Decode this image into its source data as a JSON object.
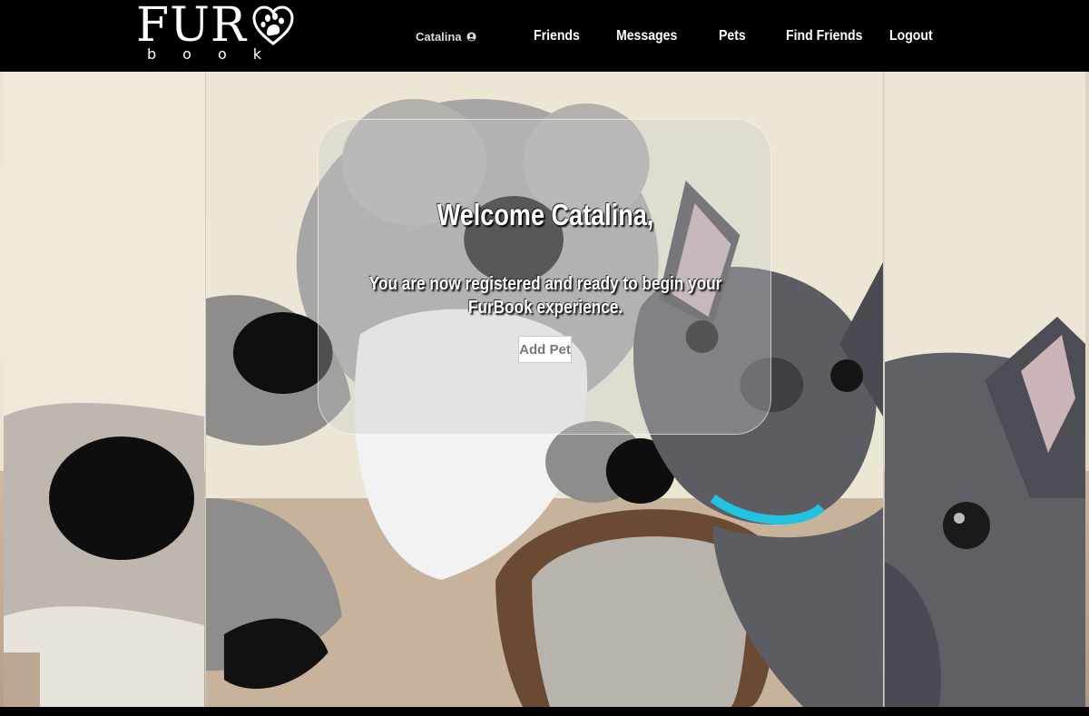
{
  "brand": {
    "name_top": "FUR",
    "name_bottom": "book"
  },
  "nav": {
    "user_name": "Catalina",
    "user_icon": "user-circle-icon",
    "links": [
      "Friends",
      "Messages",
      "Pets",
      "Find Friends",
      "Logout"
    ]
  },
  "card": {
    "title": "Welcome Catalina,",
    "message": "You are now registered and ready to begin your FurBook experience.",
    "button_label": "Add Pet"
  },
  "colors": {
    "navbar_bg": "#000000",
    "text": "#ffffff",
    "button_bg": "#ffffff",
    "button_text": "#777777"
  }
}
